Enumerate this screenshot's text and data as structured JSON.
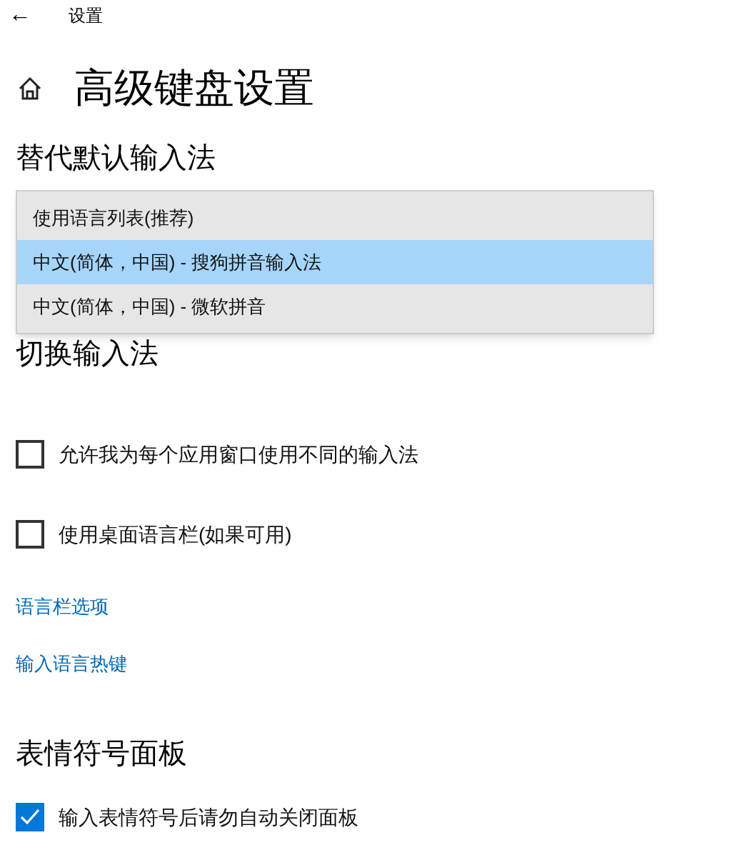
{
  "header": {
    "back": "←",
    "title": "设置"
  },
  "page_title": "高级键盘设置",
  "override_section": {
    "heading": "替代默认输入法",
    "dropdown_options": [
      {
        "label": "使用语言列表(推荐)",
        "selected": false
      },
      {
        "label": "中文(简体，中国) - 搜狗拼音输入法",
        "selected": true
      },
      {
        "label": "中文(简体，中国) - 微软拼音",
        "selected": false
      }
    ]
  },
  "switch_section": {
    "heading": "切换输入法",
    "checkboxes": [
      {
        "label": "允许我为每个应用窗口使用不同的输入法",
        "checked": false
      },
      {
        "label": "使用桌面语言栏(如果可用)",
        "checked": false
      }
    ],
    "links": [
      "语言栏选项",
      "输入语言热键"
    ]
  },
  "emoji_section": {
    "heading": "表情符号面板",
    "checkboxes": [
      {
        "label": "输入表情符号后请勿自动关闭面板",
        "checked": true
      }
    ]
  }
}
